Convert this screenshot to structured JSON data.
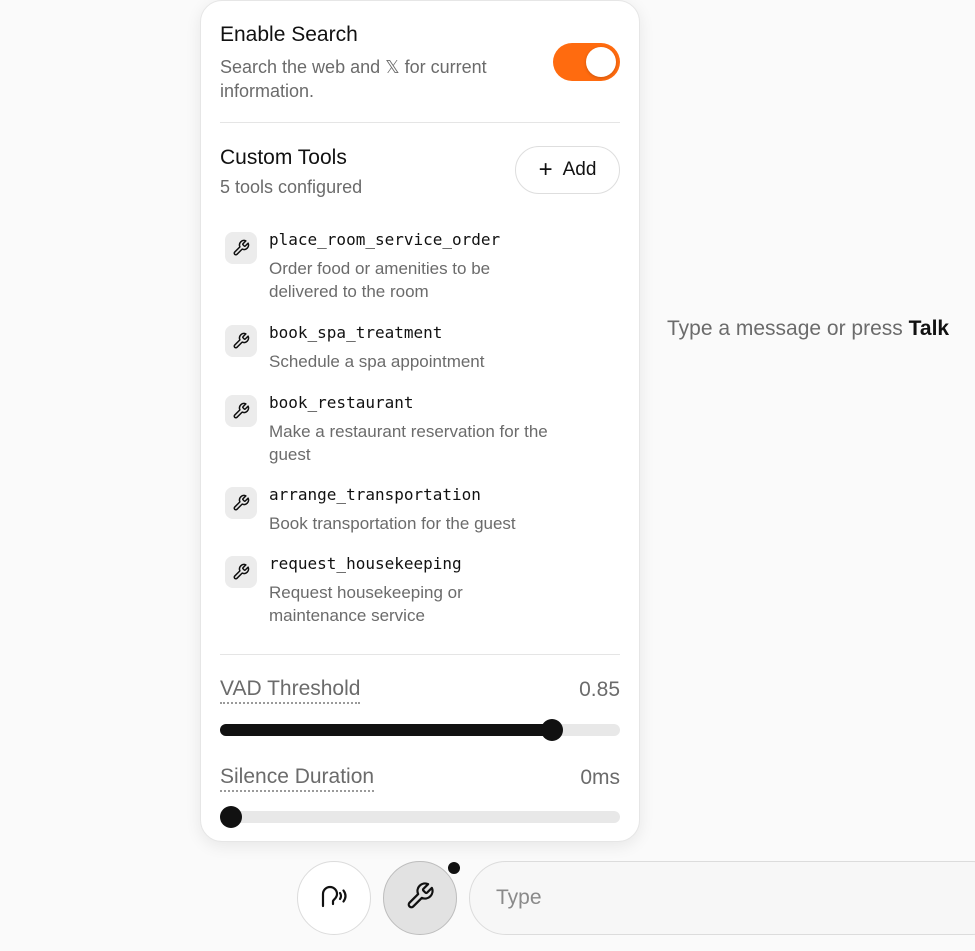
{
  "search": {
    "title": "Enable Search",
    "description": "Search the web and 𝕏 for current information.",
    "enabled": true,
    "toggle_color": "#ff6b0f"
  },
  "custom_tools": {
    "title": "Custom Tools",
    "count_text": "5 tools configured",
    "add_label": "Add",
    "items": [
      {
        "name": "place_room_service_order",
        "description": "Order food or amenities to be delivered to the room",
        "icon": "wrench-icon"
      },
      {
        "name": "book_spa_treatment",
        "description": "Schedule a spa appointment",
        "icon": "wrench-icon"
      },
      {
        "name": "book_restaurant",
        "description": "Make a restaurant reservation for the guest",
        "icon": "wrench-icon"
      },
      {
        "name": "arrange_transportation",
        "description": "Book transportation for the guest",
        "icon": "wrench-icon"
      },
      {
        "name": "request_housekeeping",
        "description": "Request housekeeping or maintenance service",
        "icon": "wrench-icon"
      }
    ]
  },
  "vad": {
    "label": "VAD Threshold",
    "value_text": "0.85",
    "value": 0.85
  },
  "silence": {
    "label": "Silence Duration",
    "value_text": "0ms",
    "value": 0
  },
  "hint": {
    "prefix": "Type a message or press ",
    "bold": "Talk"
  },
  "composer": {
    "placeholder": "Type",
    "voice_icon": "voice-icon",
    "tools_icon": "wrench-icon",
    "tools_active": true
  }
}
